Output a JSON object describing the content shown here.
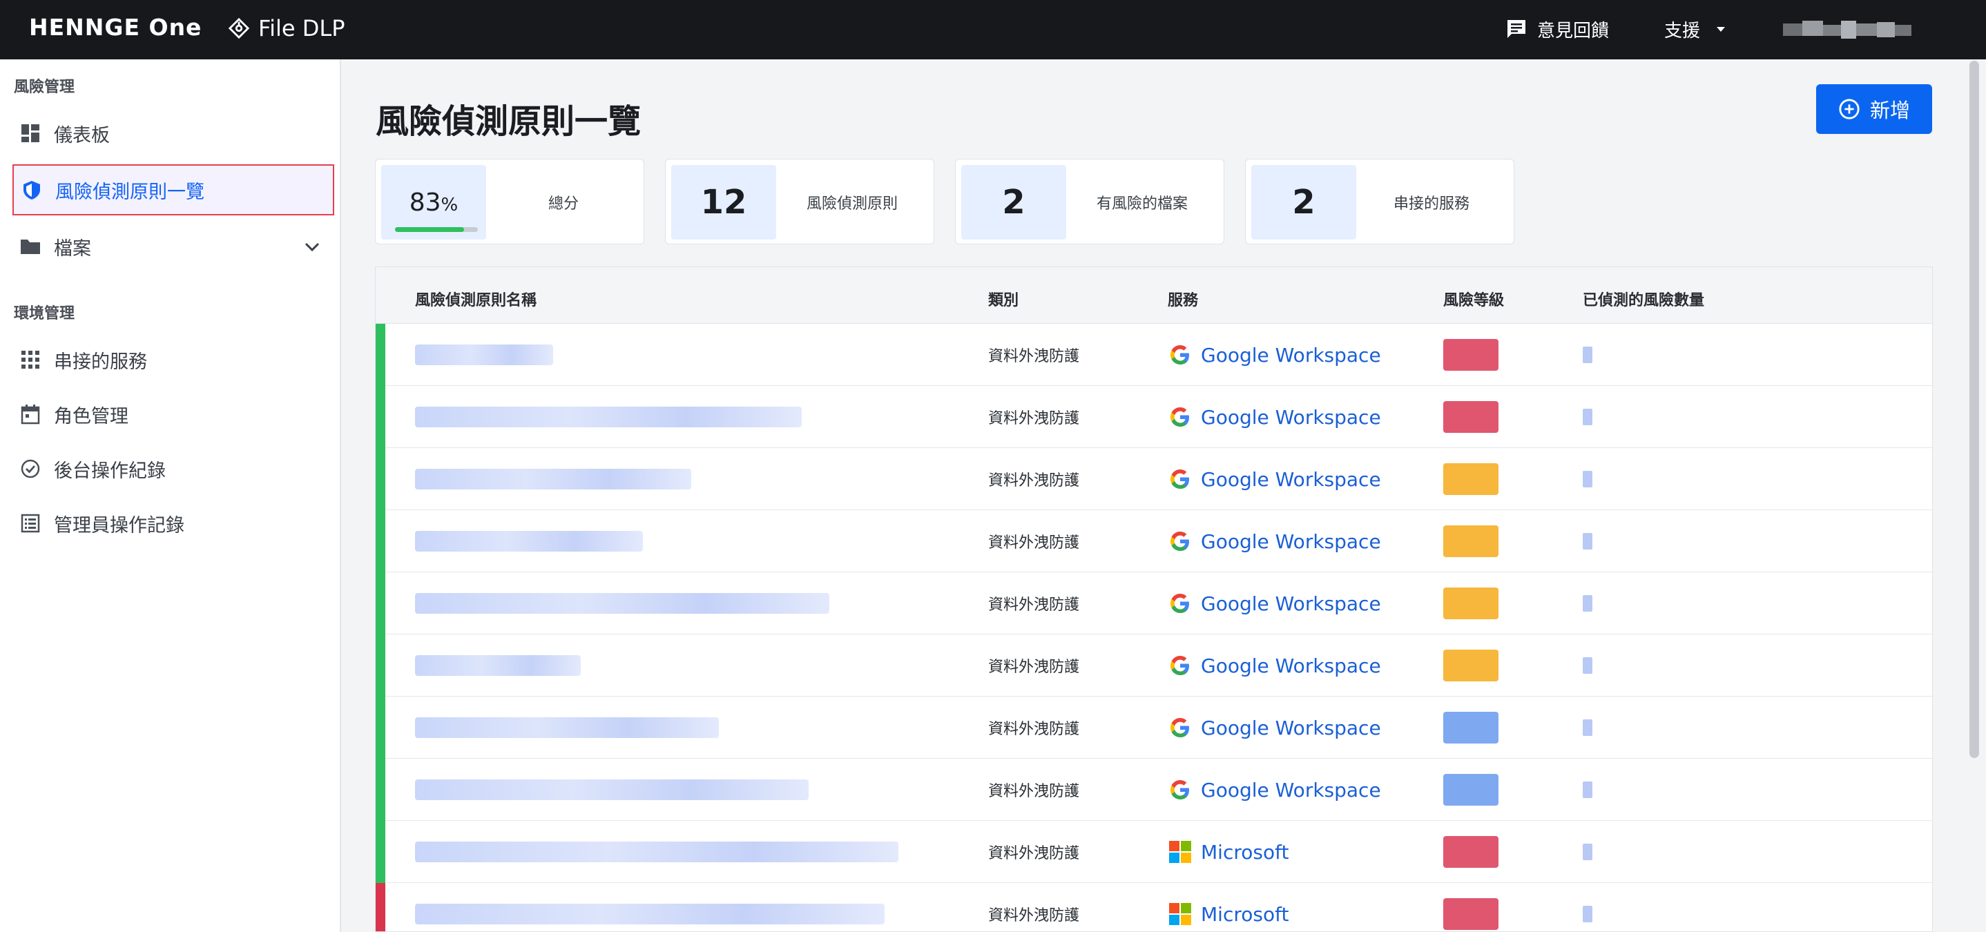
{
  "topbar": {
    "brand": "HENNGE One",
    "product": "File DLP",
    "feedback": "意見回饋",
    "support": "支援"
  },
  "sidebar": {
    "section_risk": "風險管理",
    "section_env": "環境管理",
    "items": [
      {
        "label": "儀表板",
        "icon": "dashboard-icon"
      },
      {
        "label": "風險偵測原則一覽",
        "icon": "shield-icon",
        "active": true
      },
      {
        "label": "檔案",
        "icon": "folder-icon"
      },
      {
        "label": "串接的服務",
        "icon": "apps-grid-icon"
      },
      {
        "label": "角色管理",
        "icon": "calendar-icon"
      },
      {
        "label": "後台操作紀錄",
        "icon": "check-circle-icon"
      },
      {
        "label": "管理員操作記錄",
        "icon": "list-icon"
      }
    ]
  },
  "main": {
    "title": "風險偵測原則一覽",
    "add_button": "新增",
    "stats": [
      {
        "value": "83",
        "unit": "%",
        "label": "總分",
        "progress": 0.83
      },
      {
        "value": "12",
        "label": "風險偵測原則"
      },
      {
        "value": "2",
        "label": "有風險的檔案"
      },
      {
        "value": "2",
        "label": "串接的服務"
      }
    ]
  },
  "table": {
    "columns": [
      "風險偵測原則名稱",
      "類別",
      "服務",
      "風險等級",
      "已偵測的風險數量"
    ],
    "rows": [
      {
        "category": "資料外洩防護",
        "service": "Google Workspace",
        "service_icon": "google-icon",
        "status_color": "#2fbf5f",
        "level_color": "#e0566f"
      },
      {
        "category": "資料外洩防護",
        "service": "Google Workspace",
        "service_icon": "google-icon",
        "status_color": "#2fbf5f",
        "level_color": "#e0566f"
      },
      {
        "category": "資料外洩防護",
        "service": "Google Workspace",
        "service_icon": "google-icon",
        "status_color": "#2fbf5f",
        "level_color": "#f6b73c"
      },
      {
        "category": "資料外洩防護",
        "service": "Google Workspace",
        "service_icon": "google-icon",
        "status_color": "#2fbf5f",
        "level_color": "#f6b73c"
      },
      {
        "category": "資料外洩防護",
        "service": "Google Workspace",
        "service_icon": "google-icon",
        "status_color": "#2fbf5f",
        "level_color": "#f6b73c"
      },
      {
        "category": "資料外洩防護",
        "service": "Google Workspace",
        "service_icon": "google-icon",
        "status_color": "#2fbf5f",
        "level_color": "#f6b73c"
      },
      {
        "category": "資料外洩防護",
        "service": "Google Workspace",
        "service_icon": "google-icon",
        "status_color": "#2fbf5f",
        "level_color": "#7ea9f0"
      },
      {
        "category": "資料外洩防護",
        "service": "Google Workspace",
        "service_icon": "google-icon",
        "status_color": "#2fbf5f",
        "level_color": "#7ea9f0"
      },
      {
        "category": "資料外洩防護",
        "service": "Microsoft",
        "service_icon": "microsoft-icon",
        "status_color": "#2fbf5f",
        "level_color": "#e0566f"
      },
      {
        "category": "資料外洩防護",
        "service": "Microsoft",
        "service_icon": "microsoft-icon",
        "status_color": "#d9344e",
        "level_color": "#e0566f"
      }
    ]
  }
}
